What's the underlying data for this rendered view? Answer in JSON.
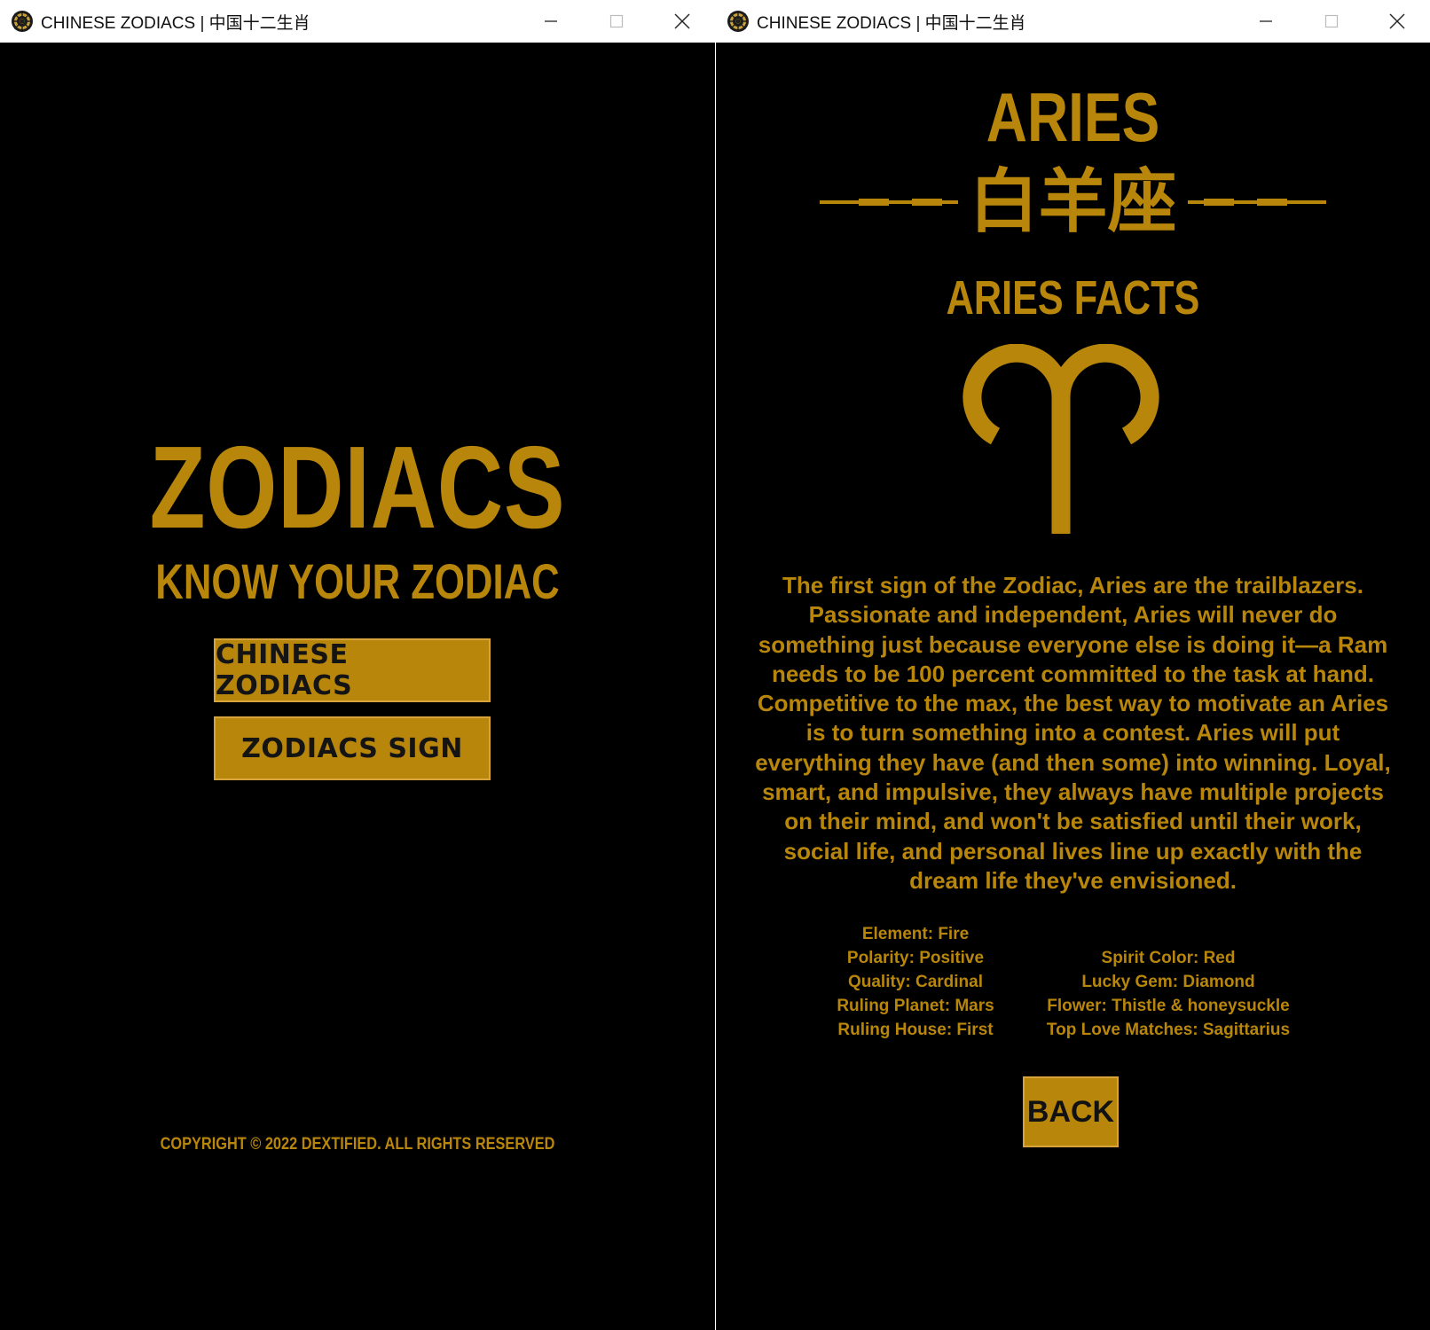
{
  "app": {
    "window_title": "CHINESE ZODIACS | 中国十二生肖",
    "icon": "yin-yang-zodiac-wheel-icon",
    "controls": [
      "minimize-icon",
      "maximize-icon",
      "close-icon"
    ]
  },
  "home": {
    "title": "ZODIACS",
    "subtitle": "KNOW YOUR ZODIAC",
    "buttons": {
      "chinese_zodiacs": "CHINESE ZODIACS",
      "zodiac_signs": "ZODIACS SIGN"
    },
    "copyright": "COPYRIGHT © 2022 DEXTIFIED. ALL RIGHTS RESERVED"
  },
  "sign": {
    "name": "ARIES",
    "chinese_name": "白羊座",
    "facts_heading": "ARIES FACTS",
    "symbol_icon": "aries-ram-symbol-icon",
    "description": "The first sign of the Zodiac, Aries are the trailblazers. Passionate and independent, Aries will never do something just because everyone else is doing it—a Ram needs to be 100 percent committed to the task at hand. Competitive to the max, the best way to motivate an Aries is to turn something into a contest. Aries will put everything they have (and then some) into winning. Loyal, smart, and impulsive, they always have multiple projects on their mind, and won't be satisfied until their work, social life, and personal lives line up exactly with the dream life they've envisioned.",
    "facts_left": [
      "Element: Fire",
      "Polarity: Positive",
      "Quality: Cardinal",
      "Ruling Planet: Mars",
      "Ruling House: First"
    ],
    "facts_right": [
      "Spirit Color: Red",
      "Lucky Gem: Diamond",
      "Flower: Thistle & honeysuckle",
      "Top Love Matches: Sagittarius"
    ],
    "back_label": "BACK"
  },
  "colors": {
    "background": "#000000",
    "gold": "#b8860b",
    "button_text": "#141414",
    "titlebar": "#ffffff"
  }
}
